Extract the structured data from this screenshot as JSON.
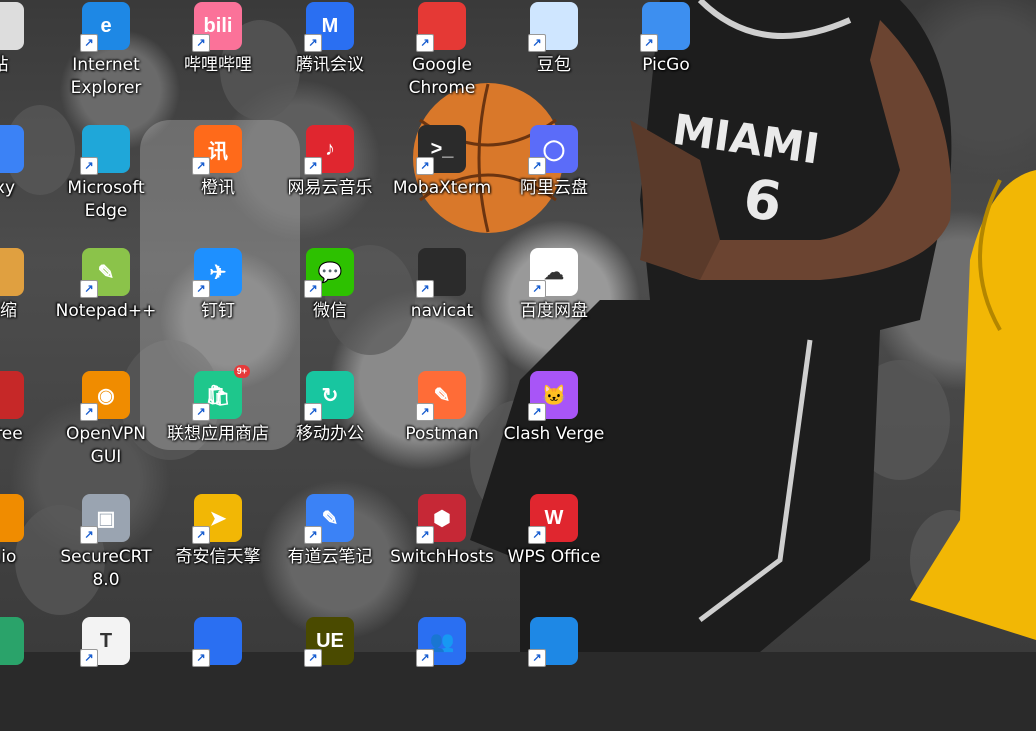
{
  "desktop": {
    "icons": [
      {
        "label": "站",
        "glyph": "",
        "color": "#dddddd",
        "icon": "recycle-bin-icon"
      },
      {
        "label": "Internet Explorer",
        "glyph": "e",
        "color": "#1e88e5",
        "icon": "internet-explorer-icon"
      },
      {
        "label": "哔哩哔哩",
        "glyph": "bili",
        "color": "#fb7299",
        "icon": "bilibili-icon"
      },
      {
        "label": "腾讯会议",
        "glyph": "M",
        "color": "#2a6ff2",
        "icon": "tencent-meeting-icon"
      },
      {
        "label": "Google Chrome",
        "glyph": "",
        "color": "#e53935",
        "icon": "chrome-icon"
      },
      {
        "label": "豆包",
        "glyph": "",
        "color": "#cfe6ff",
        "icon": "doubao-icon"
      },
      {
        "label": "PicGo",
        "glyph": "",
        "color": "#3d8ff0",
        "icon": "picgo-icon"
      },
      {
        "label": "oxy",
        "glyph": "",
        "color": "#3b82f6",
        "icon": "proxy-icon"
      },
      {
        "label": "Microsoft Edge",
        "glyph": "",
        "color": "#1fa7d9",
        "icon": "edge-icon"
      },
      {
        "label": "橙讯",
        "glyph": "讯",
        "color": "#ff6a1a",
        "icon": "chengxun-icon"
      },
      {
        "label": "网易云音乐",
        "glyph": "♪",
        "color": "#e0262f",
        "icon": "netease-music-icon"
      },
      {
        "label": "MobaXterm",
        "glyph": ">_",
        "color": "#2b2b2b",
        "icon": "mobaxterm-icon"
      },
      {
        "label": "阿里云盘",
        "glyph": "◯",
        "color": "#5b6cf9",
        "icon": "aliyun-drive-icon"
      },
      {
        "label": "压缩",
        "glyph": "",
        "color": "#e0a040",
        "icon": "archive-icon"
      },
      {
        "label": "Notepad++",
        "glyph": "✎",
        "color": "#8bc34a",
        "icon": "notepadpp-icon"
      },
      {
        "label": "钉钉",
        "glyph": "✈",
        "color": "#1e90ff",
        "icon": "dingtalk-icon"
      },
      {
        "label": "微信",
        "glyph": "💬",
        "color": "#2dc100",
        "icon": "wechat-icon"
      },
      {
        "label": "navicat",
        "glyph": "",
        "color": "#2b2b2b",
        "icon": "navicat-icon"
      },
      {
        "label": "百度网盘",
        "glyph": "☁",
        "color": "#ffffff",
        "icon": "baidu-netdisk-icon"
      },
      {
        "label": "vTree",
        "glyph": "",
        "color": "#c62828",
        "icon": "sourcetree-icon"
      },
      {
        "label": "OpenVPN GUI",
        "glyph": "◉",
        "color": "#f08c00",
        "icon": "openvpn-icon"
      },
      {
        "label": "联想应用商店",
        "glyph": "🛍",
        "color": "#1ec78c",
        "icon": "lenovo-store-icon"
      },
      {
        "label": "移动办公",
        "glyph": "↻",
        "color": "#18c6a0",
        "icon": "mobile-office-icon"
      },
      {
        "label": "Postman",
        "glyph": "✎",
        "color": "#ff6c37",
        "icon": "postman-icon"
      },
      {
        "label": "Clash Verge",
        "glyph": "🐱",
        "color": "#a855f7",
        "icon": "clash-verge-icon"
      },
      {
        "label": "w.io",
        "glyph": "",
        "color": "#f08c00",
        "icon": "drawio-icon"
      },
      {
        "label": "SecureCRT 8.0",
        "glyph": "▣",
        "color": "#9aa4b1",
        "icon": "securecrt-icon"
      },
      {
        "label": "奇安信天擎",
        "glyph": "➤",
        "color": "#f2b705",
        "icon": "qianxin-icon"
      },
      {
        "label": "有道云笔记",
        "glyph": "✎",
        "color": "#3b82f6",
        "icon": "youdao-note-icon"
      },
      {
        "label": "SwitchHosts",
        "glyph": "⬢",
        "color": "#c62836",
        "icon": "switchhosts-icon"
      },
      {
        "label": "WPS Office",
        "glyph": "W",
        "color": "#e0262f",
        "icon": "wps-icon"
      },
      {
        "label": "",
        "glyph": "",
        "color": "#2aa36a",
        "icon": "partial-icon"
      },
      {
        "label": "",
        "glyph": "T",
        "color": "#f3f3f3",
        "icon": "typora-icon"
      },
      {
        "label": "",
        "glyph": "",
        "color": "#2a6ff2",
        "icon": "partial-icon"
      },
      {
        "label": "",
        "glyph": "UE",
        "color": "#4a4a00",
        "icon": "ultraedit-icon"
      },
      {
        "label": "",
        "glyph": "👥",
        "color": "#2a6ff2",
        "icon": "contacts-icon"
      },
      {
        "label": "",
        "glyph": "",
        "color": "#1e88e5",
        "icon": "partial-icon"
      }
    ],
    "badge_text": "9+",
    "jersey": {
      "team": "MIAMI",
      "number": "6"
    }
  }
}
